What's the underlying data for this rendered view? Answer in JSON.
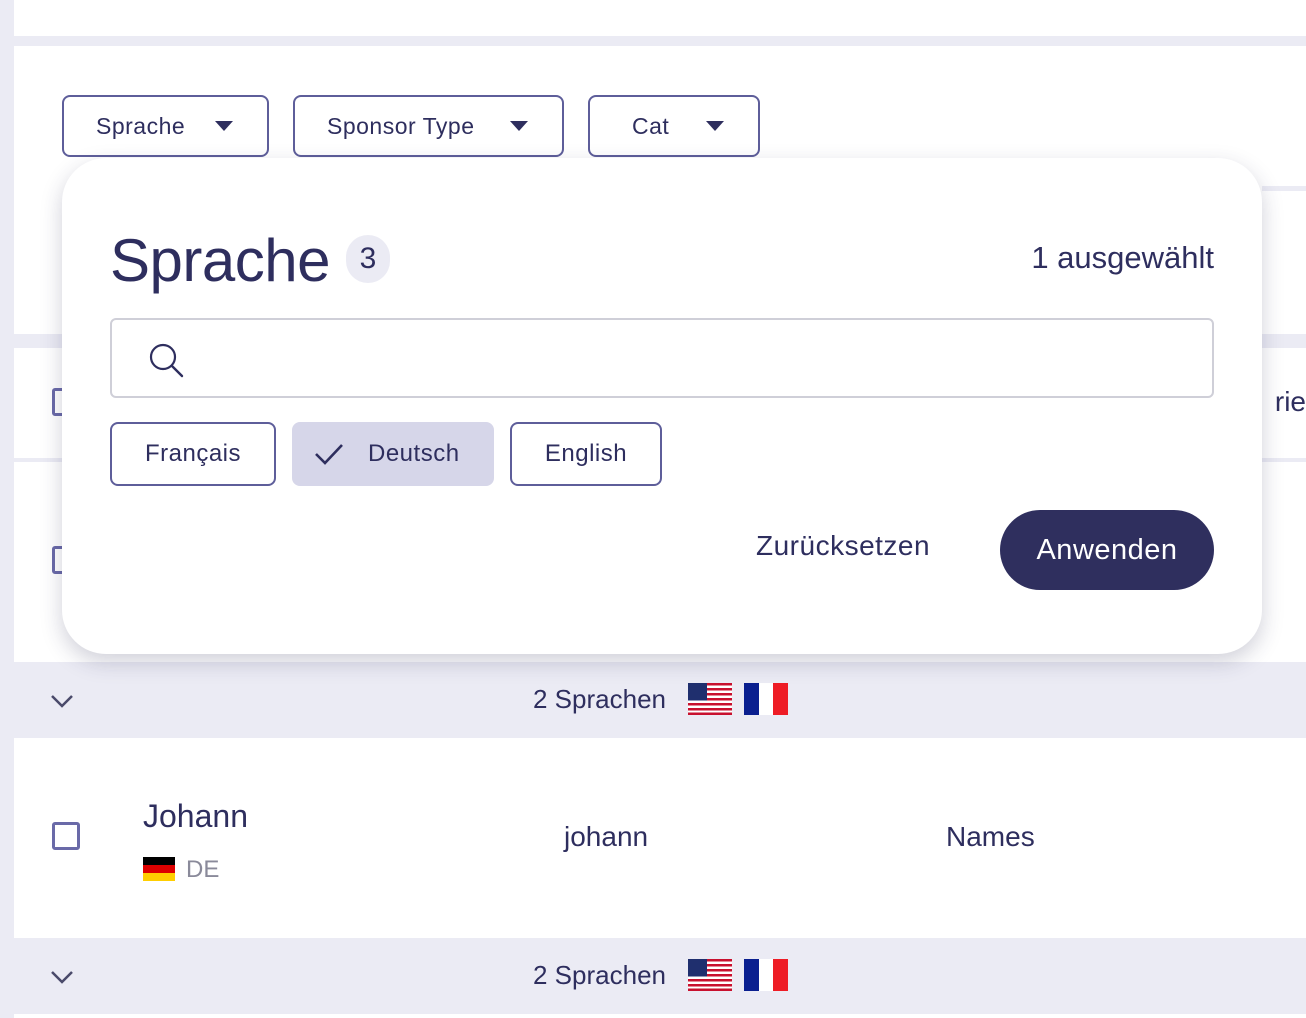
{
  "filters": [
    {
      "label": "Sprache"
    },
    {
      "label": "Sponsor Type"
    },
    {
      "label": "Cat"
    }
  ],
  "modal": {
    "title": "Sprache",
    "count": "3",
    "selected_text": "1 ausgewählt",
    "search": {
      "value": "",
      "placeholder": ""
    },
    "options": [
      {
        "label": "Français",
        "selected": false
      },
      {
        "label": "Deutsch",
        "selected": true
      },
      {
        "label": "English",
        "selected": false
      }
    ],
    "reset_label": "Zurücksetzen",
    "apply_label": "Anwenden"
  },
  "table": {
    "partial_header": "rie",
    "rows": [
      {
        "languages_summary": "2 Sprachen",
        "flags": [
          "us-flag-icon",
          "fr-flag-icon"
        ]
      },
      {
        "name": "Johann",
        "lang_code": "DE",
        "lang_flag": "de-flag-icon",
        "key": "johann",
        "category": "Names",
        "languages_summary": "2 Sprachen",
        "flags": [
          "us-flag-icon",
          "fr-flag-icon"
        ]
      }
    ]
  },
  "colors": {
    "accent": "#2f2f5e",
    "selected_chip": "#d6d6e9",
    "border": "#5e5e9a",
    "background_gray": "#ebebf4"
  }
}
